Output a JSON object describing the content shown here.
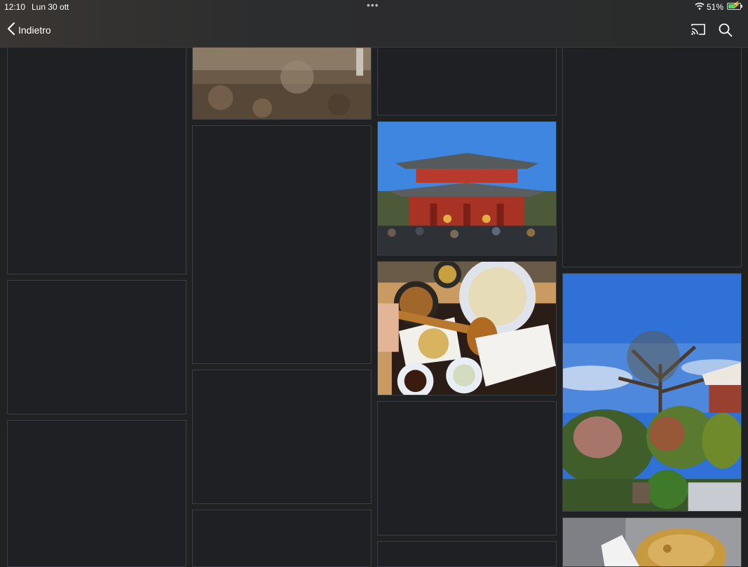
{
  "status": {
    "time": "12:10",
    "date": "Lun 30 ott",
    "battery": "51%"
  },
  "nav": {
    "back_label": "Indietro"
  },
  "icons": {
    "back": "chevron-left-icon",
    "cast": "cast-icon",
    "search": "search-icon"
  },
  "colors": {
    "background": "#1f2123",
    "tile_border": "#3b3e42",
    "battery_fill": "#4cd964"
  }
}
